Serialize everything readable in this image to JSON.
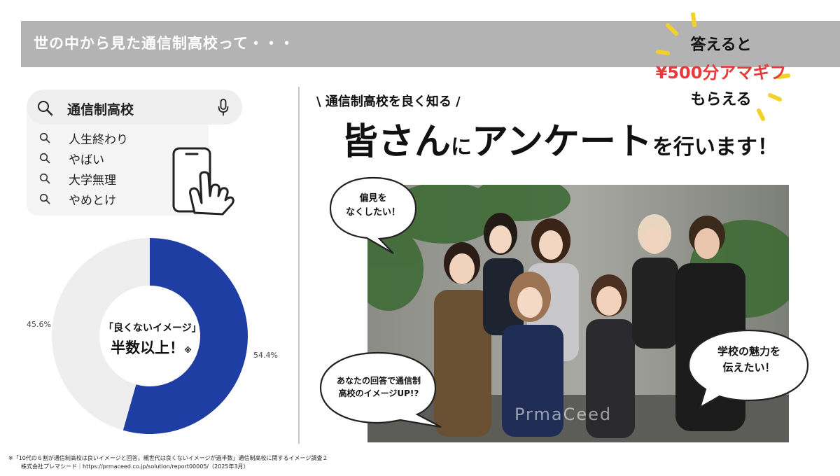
{
  "header": {
    "title": "世の中から見た通信制高校って・・・"
  },
  "search": {
    "query": "通信制高校",
    "suggestions": [
      "人生終わり",
      "やばい",
      "大学無理",
      "やめとけ"
    ]
  },
  "donut": {
    "values": [
      54.4,
      45.6
    ],
    "labels": [
      "54.4%",
      "45.6%"
    ],
    "colors": [
      "#1f3ea4",
      "#eeeeee"
    ],
    "center_line1": "「良くないイメージ」",
    "center_line2": "半数以上！",
    "center_mark": "※"
  },
  "right": {
    "sub_heading": "\\ 通信制高校を良く知る /",
    "heading_part1": "皆さん",
    "heading_part2": "に",
    "heading_part3": "アンケート",
    "heading_part4": "を行います！"
  },
  "promo": {
    "line1": "答えると",
    "line2": "¥500分アマギフ",
    "line3": "もらえる",
    "accent_color": "#e83a3a",
    "burst_color": "#f2d12a"
  },
  "bubbles": {
    "left_top_line1": "偏見を",
    "left_top_line2": "なくしたい！",
    "right_line1": "学校の魅力を",
    "right_line2": "伝えたい！",
    "left_bottom_line1": "あなたの回答で通信制",
    "left_bottom_line2": "高校のイメージUP!?"
  },
  "photo": {
    "watermark": "PrmaCeed"
  },
  "footnote": {
    "line1": "※「10代の６割が通信制高校は良いイメージと回答。親世代は良くないイメージが過半数」通信制高校に関するイメージ調査２",
    "line2": "株式会社プレマシード｜https://prmaceed.co.jp/solution/report00005/（2025年3月）"
  }
}
